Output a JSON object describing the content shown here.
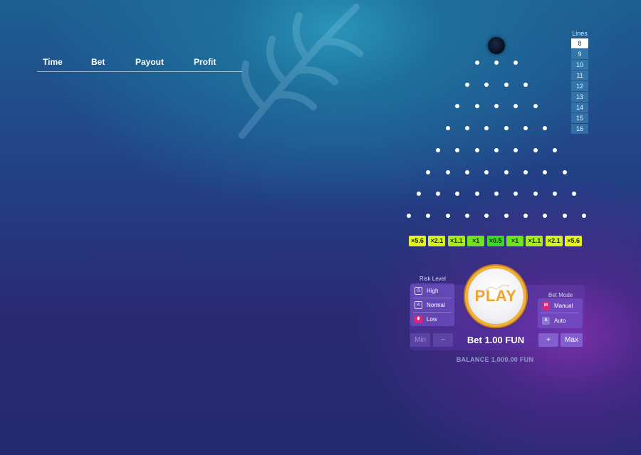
{
  "history": {
    "headers": [
      "Time",
      "Bet",
      "Payout",
      "Profit"
    ]
  },
  "lines": {
    "title": "Lines",
    "options": [
      "8",
      "9",
      "10",
      "11",
      "12",
      "13",
      "14",
      "15",
      "16"
    ],
    "selected": "8"
  },
  "multipliers": [
    {
      "label": "×5.6",
      "color": "#e6f21b"
    },
    {
      "label": "×2.1",
      "color": "#d6f21b"
    },
    {
      "label": "×1.1",
      "color": "#a6ec1e"
    },
    {
      "label": "×1",
      "color": "#6fe41e"
    },
    {
      "label": "×0.5",
      "color": "#3ad822"
    },
    {
      "label": "×1",
      "color": "#6fe41e"
    },
    {
      "label": "×1.1",
      "color": "#a6ec1e"
    },
    {
      "label": "×2.1",
      "color": "#d6f21b"
    },
    {
      "label": "×5.6",
      "color": "#e6f21b"
    }
  ],
  "risk": {
    "title": "Risk Level",
    "options": [
      {
        "label": "High",
        "icon": "clock-icon"
      },
      {
        "label": "Normal",
        "icon": "stopwatch-icon"
      },
      {
        "label": "Low",
        "icon": "shield-icon"
      }
    ]
  },
  "bet_mode": {
    "title": "Bet Mode",
    "options": [
      {
        "label": "Manual",
        "badge": "M"
      },
      {
        "label": "Auto",
        "badge": "A"
      }
    ]
  },
  "play": {
    "label": "PLAY"
  },
  "bet": {
    "text": "Bet 1.00 FUN",
    "min_label": "Min",
    "minus_label": "−",
    "plus_label": "+",
    "max_label": "Max"
  },
  "balance": {
    "text": "BALANCE 1,000.00 FUN"
  },
  "colors": {
    "accent_orange": "#f0a22c",
    "panel_purple": "#7a5ad2"
  }
}
